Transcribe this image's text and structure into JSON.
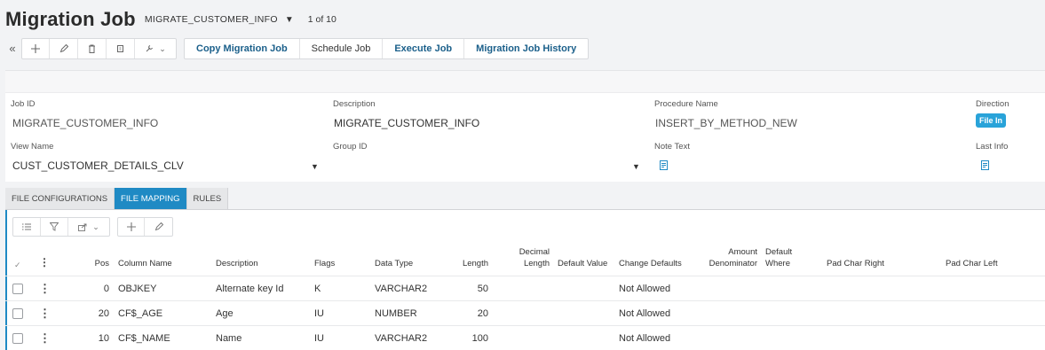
{
  "header": {
    "title": "Migration Job",
    "record_key": "MIGRATE_CUSTOMER_INFO",
    "record_nav": "1 of 10"
  },
  "toolbar": {
    "commands": [
      "Copy Migration Job",
      "Schedule Job",
      "Execute Job",
      "Migration Job History"
    ]
  },
  "form": {
    "job_id_label": "Job ID",
    "job_id_value": "MIGRATE_CUSTOMER_INFO",
    "description_label": "Description",
    "description_value": "MIGRATE_CUSTOMER_INFO",
    "procedure_label": "Procedure Name",
    "procedure_value": "INSERT_BY_METHOD_NEW",
    "direction_label": "Direction",
    "direction_value": "File In",
    "view_name_label": "View Name",
    "view_name_value": "CUST_CUSTOMER_DETAILS_CLV",
    "group_id_label": "Group ID",
    "group_id_value": "",
    "note_text_label": "Note Text",
    "last_info_label": "Last Info"
  },
  "tabs": [
    {
      "label": "FILE CONFIGURATIONS",
      "active": false
    },
    {
      "label": "FILE MAPPING",
      "active": true
    },
    {
      "label": "RULES",
      "active": false
    }
  ],
  "table": {
    "headers": {
      "pos": "Pos",
      "column_name": "Column Name",
      "description": "Description",
      "flags": "Flags",
      "data_type": "Data Type",
      "length": "Length",
      "decimal_length_1": "Decimal",
      "decimal_length_2": "Length",
      "default_value": "Default Value",
      "change_defaults": "Change Defaults",
      "amount_denominator_1": "Amount",
      "amount_denominator_2": "Denominator",
      "default_where_1": "Default",
      "default_where_2": "Where",
      "pad_char_right": "Pad Char Right",
      "pad_char_left": "Pad Char Left"
    },
    "rows": [
      {
        "pos": "0",
        "column_name": "OBJKEY",
        "description": "Alternate key Id",
        "flags": "K",
        "data_type": "VARCHAR2",
        "length": "50",
        "change_defaults": "Not Allowed"
      },
      {
        "pos": "20",
        "column_name": "CF$_AGE",
        "description": "Age",
        "flags": "IU",
        "data_type": "NUMBER",
        "length": "20",
        "change_defaults": "Not Allowed"
      },
      {
        "pos": "10",
        "column_name": "CF$_NAME",
        "description": "Name",
        "flags": "IU",
        "data_type": "VARCHAR2",
        "length": "100",
        "change_defaults": "Not Allowed"
      }
    ]
  },
  "colors": {
    "accent": "#1f8ac4",
    "badge": "#29a3d9",
    "command_text": "#1a5f8a"
  }
}
